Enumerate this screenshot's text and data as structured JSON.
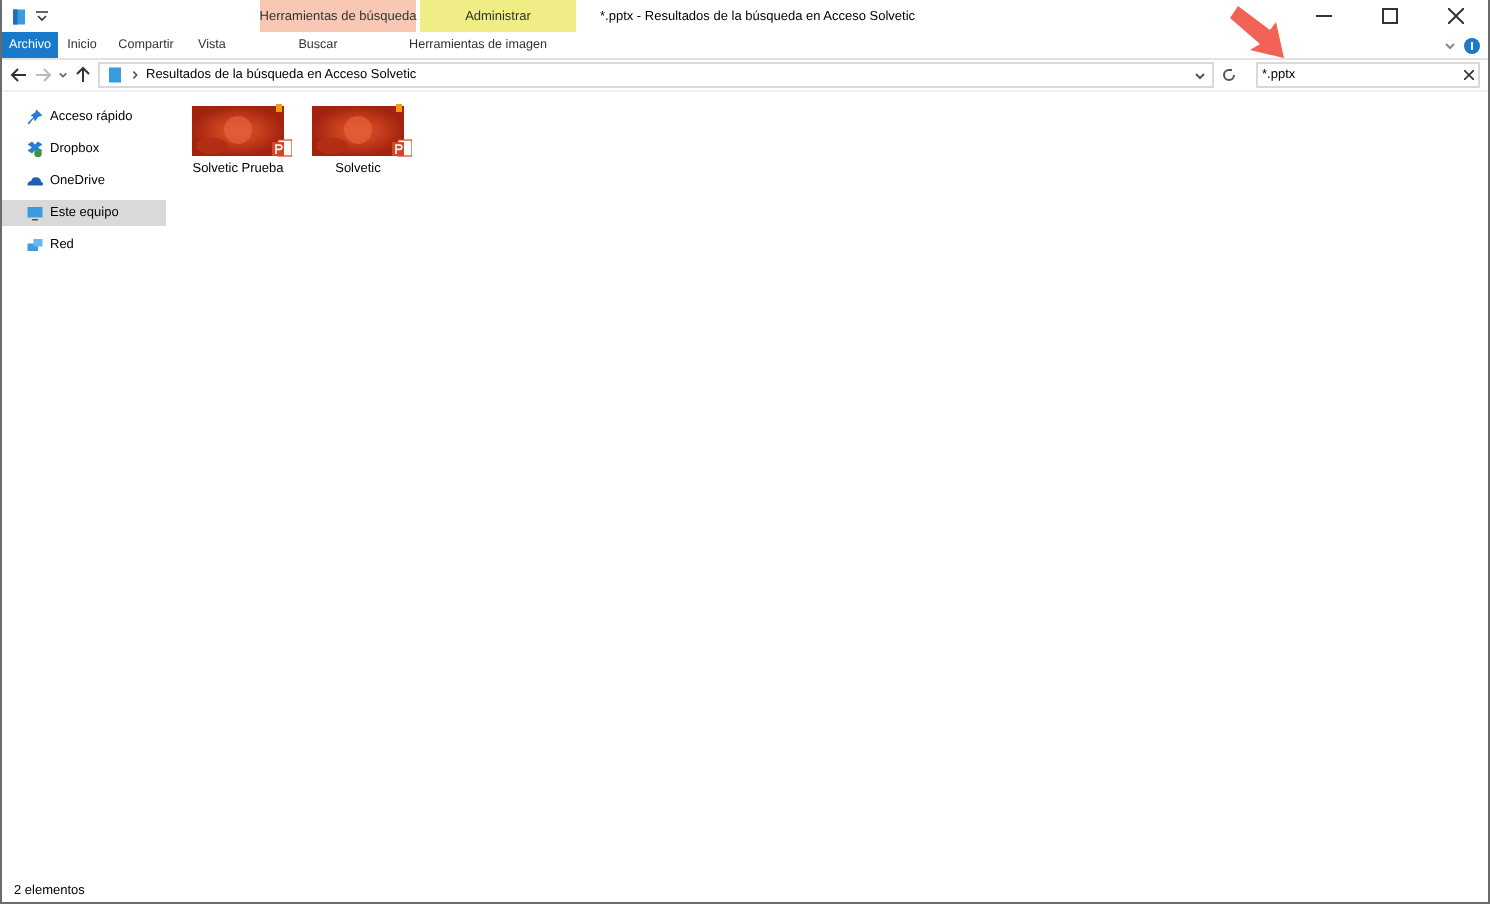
{
  "window": {
    "title": "*.pptx - Resultados de la búsqueda en Acceso Solvetic"
  },
  "context_tabs": [
    {
      "label": "Herramientas de búsqueda",
      "color": "#f9c8b4"
    },
    {
      "label": "Administrar",
      "color": "#f0ec86"
    }
  ],
  "ribbon_tabs": [
    {
      "label": "Archivo",
      "selected": true
    },
    {
      "label": "Inicio",
      "selected": false
    },
    {
      "label": "Compartir",
      "selected": false
    },
    {
      "label": "Vista",
      "selected": false
    },
    {
      "label": "Buscar",
      "selected": false
    },
    {
      "label": "Herramientas de imagen",
      "selected": false
    }
  ],
  "address": {
    "path": "Resultados de la búsqueda en Acceso Solvetic"
  },
  "search": {
    "value": "*.pptx"
  },
  "sidebar": {
    "items": [
      {
        "label": "Acceso rápido",
        "selected": false
      },
      {
        "label": "Dropbox",
        "selected": false
      },
      {
        "label": "OneDrive",
        "selected": false
      },
      {
        "label": "Este equipo",
        "selected": true
      },
      {
        "label": "Red",
        "selected": false
      }
    ]
  },
  "files": [
    {
      "name": "Solvetic Prueba",
      "kind": "picture"
    },
    {
      "name": "Solvetic",
      "kind": "picture"
    }
  ],
  "status_bar": {
    "count": "2 elementos"
  }
}
